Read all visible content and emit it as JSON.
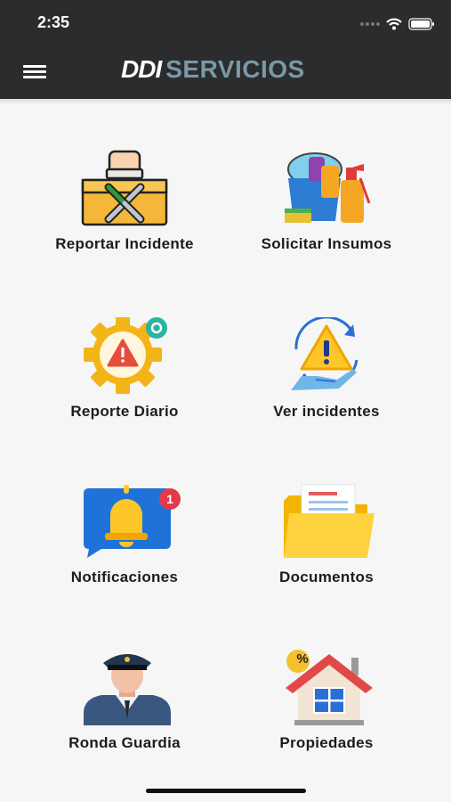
{
  "status_bar": {
    "time": "2:35"
  },
  "header": {
    "brand_part1": "DDI",
    "brand_part2": "SERVICIOS"
  },
  "menu": {
    "reportar_incidente": {
      "label": "Reportar Incidente",
      "icon": "toolbox-icon"
    },
    "solicitar_insumos": {
      "label": "Solicitar Insumos",
      "icon": "cleaning-supplies-icon"
    },
    "reporte_diario": {
      "label": "Reporte Diario",
      "icon": "gear-warning-icon"
    },
    "ver_incidentes": {
      "label": "Ver incidentes",
      "icon": "hand-warning-icon"
    },
    "notificaciones": {
      "label": "Notificaciones",
      "icon": "bell-notification-icon",
      "badge": "1"
    },
    "documentos": {
      "label": "Documentos",
      "icon": "folder-icon"
    },
    "ronda_guardia": {
      "label": "Ronda Guardia",
      "icon": "security-guard-icon"
    },
    "propiedades": {
      "label": "Propiedades",
      "icon": "house-icon",
      "house_sign": "%"
    }
  }
}
